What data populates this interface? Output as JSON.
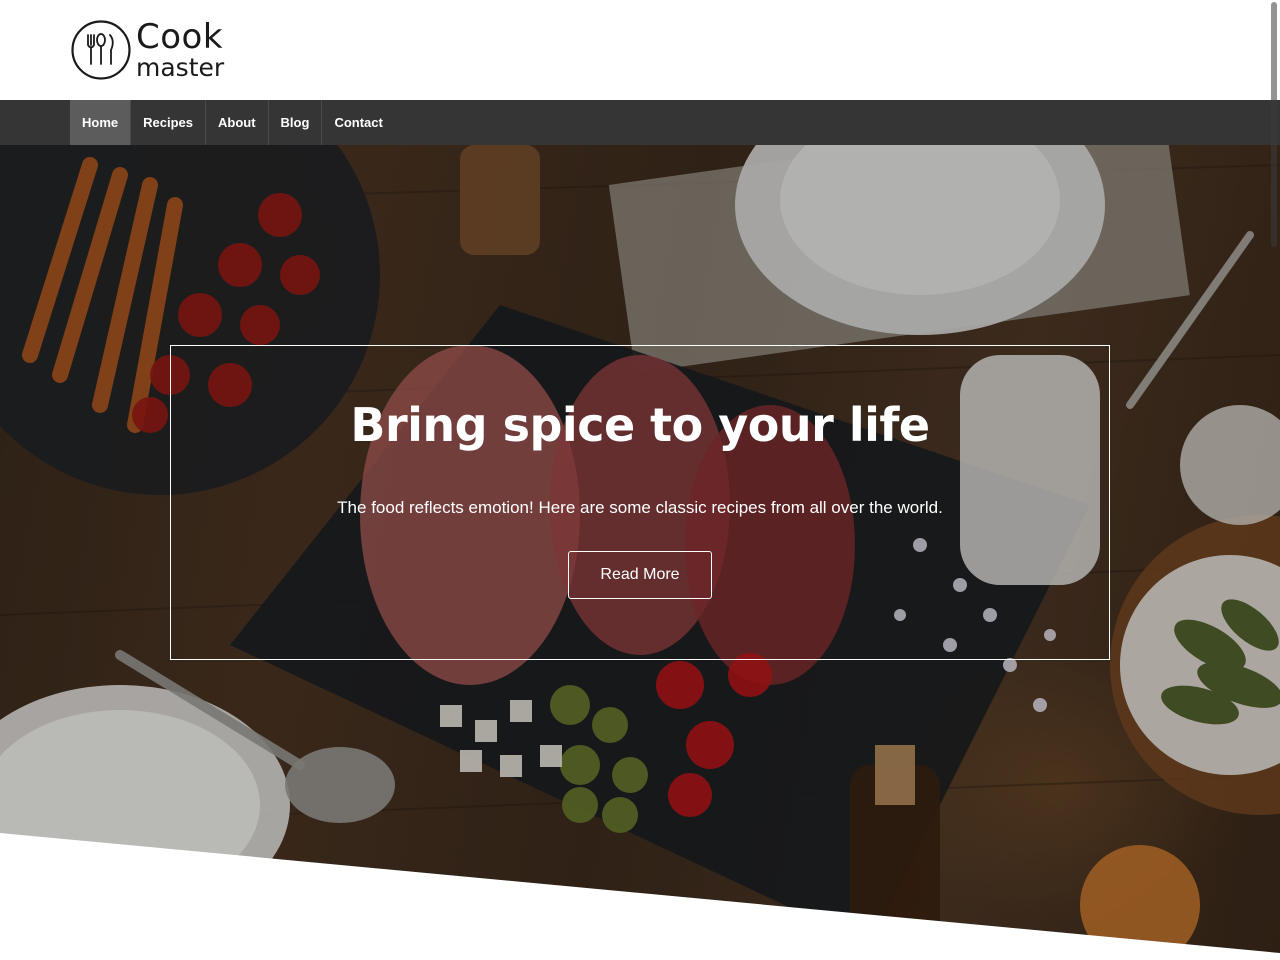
{
  "brand": {
    "line1": "Cook",
    "line2": "master",
    "logo_icon": "fork-spoon-knife-icon"
  },
  "nav": {
    "items": [
      {
        "label": "Home",
        "active": true
      },
      {
        "label": "Recipes",
        "active": false
      },
      {
        "label": "About",
        "active": false
      },
      {
        "label": "Blog",
        "active": false
      },
      {
        "label": "Contact",
        "active": false
      }
    ]
  },
  "hero": {
    "title": "Bring spice to your life",
    "subtitle": "The food reflects emotion! Here are some classic recipes from all over the world.",
    "button_label": "Read More",
    "background_image": "food-table-photo"
  },
  "colors": {
    "nav_bg": "#353535",
    "nav_active": "#5c5c5c",
    "hero_text": "#ffffff",
    "page_bg": "#ffffff"
  }
}
